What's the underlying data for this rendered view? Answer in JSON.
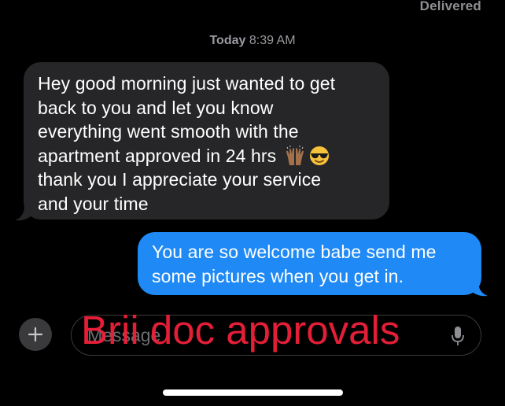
{
  "status": {
    "delivered": "Delivered"
  },
  "timestamp": {
    "day": "Today",
    "time": "8:39 AM"
  },
  "messages": [
    {
      "direction": "incoming",
      "lines": [
        "Hey good morning just wanted to get",
        "back to you and let you know",
        "everything went smooth with the",
        "apartment approved in 24 hrs",
        "thank you I appreciate your service",
        "and your time"
      ],
      "emojis": [
        "raising-hands-emoji",
        "sunglasses-emoji"
      ]
    },
    {
      "direction": "outgoing",
      "lines": [
        "You are so welcome babe send me",
        "some pictures when you get in."
      ]
    }
  ],
  "composer": {
    "placeholder": "Message",
    "plus_icon": "plus-icon",
    "mic_icon": "microphone-icon"
  },
  "overlay": {
    "watermark_text": "Brii doc approvals",
    "color": "#f0203a"
  },
  "colors": {
    "incoming_bubble": "#262628",
    "outgoing_bubble": "#1f8af5",
    "background": "#000000"
  }
}
